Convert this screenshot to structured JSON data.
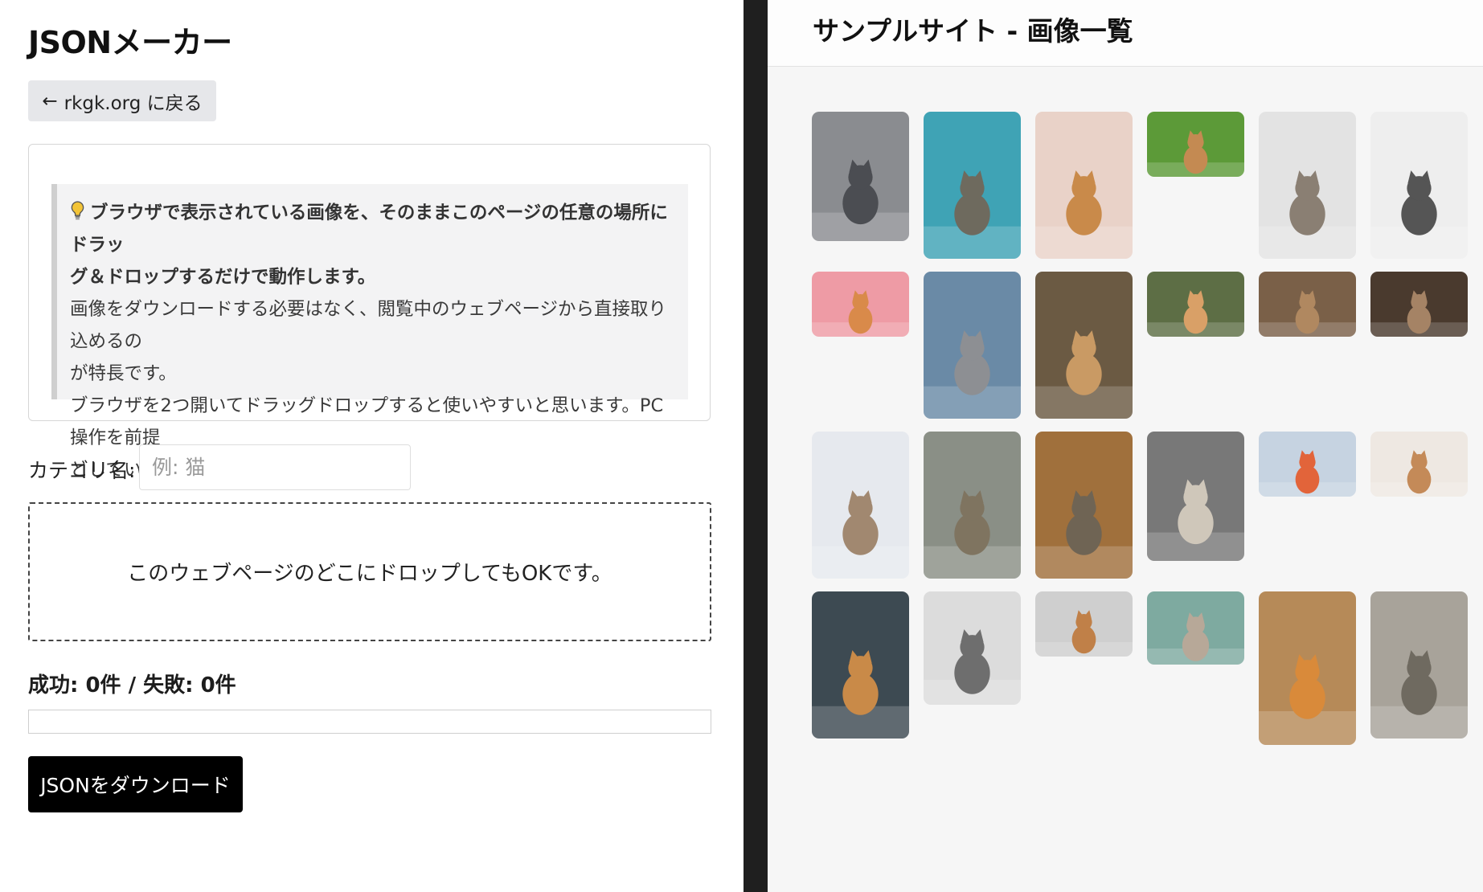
{
  "left": {
    "title": "JSONメーカー",
    "back_button": {
      "arrow": "←",
      "label": "rkgk.org に戻る"
    },
    "info": {
      "icon": "lightbulb-icon",
      "bold_line1": "ブラウザで表示されている画像を、そのままこのページの任意の場所にドラッ",
      "bold_line2": "グ＆ドロップするだけで動作します。",
      "line3": "画像をダウンロードする必要はなく、閲覧中のウェブページから直接取り込めるの",
      "line4": "が特長です。",
      "line5": "ブラウザを2つ開いてドラッグドロップすると使いやすいと思います。PC操作を前提",
      "line6": "としています。"
    },
    "category_label": "カテゴリ名:",
    "category_placeholder": "例: 猫",
    "drop_zone_text": "このウェブページのどこにドロップしてもOKです。",
    "stats_text": "成功: 0件 / 失敗: 0件",
    "progress_fraction": 0,
    "download_button": "JSONをダウンロード"
  },
  "right": {
    "site_title": "サンプルサイト - 画像一覧",
    "images": [
      {
        "name": "cat-sunglasses",
        "bg": "#8a8c90",
        "fg": "#4b4d52"
      },
      {
        "name": "cat-peeking-door",
        "bg": "#3fa3b5",
        "fg": "#6e6a5e"
      },
      {
        "name": "cat-in-box",
        "bg": "#e9d2c8",
        "fg": "#c98a4a"
      },
      {
        "name": "cat-in-grass",
        "bg": "#5c9a38",
        "fg": "#c48a52"
      },
      {
        "name": "cat-sitting-white",
        "bg": "#e3e3e3",
        "fg": "#8a7f73"
      },
      {
        "name": "cat-profile-white",
        "bg": "#eeeeee",
        "fg": "#555555"
      },
      {
        "name": "cat-pink-background",
        "bg": "#ee9ba5",
        "fg": "#d98a4a"
      },
      {
        "name": "cat-sky-portrait",
        "bg": "#6a8aa6",
        "fg": "#8d8f93"
      },
      {
        "name": "cat-fluffy-orange",
        "bg": "#6b5a43",
        "fg": "#c99a64"
      },
      {
        "name": "cat-on-path",
        "bg": "#5d6e45",
        "fg": "#d9a067"
      },
      {
        "name": "cat-on-bench",
        "bg": "#7a6048",
        "fg": "#b08860"
      },
      {
        "name": "cat-lying-dark",
        "bg": "#4a3a2e",
        "fg": "#a58365"
      },
      {
        "name": "cat-lying-white",
        "bg": "#e6e9ee",
        "fg": "#a18870"
      },
      {
        "name": "cat-jumping",
        "bg": "#8a8f86",
        "fg": "#7f7460"
      },
      {
        "name": "cat-closeup-tabby",
        "bg": "#a0703c",
        "fg": "#6f6454"
      },
      {
        "name": "cat-sitting-street",
        "bg": "#787878",
        "fg": "#cfc7ba"
      },
      {
        "name": "cat-cart",
        "bg": "#c6d3e1",
        "fg": "#e2643a"
      },
      {
        "name": "cat-windowsill",
        "bg": "#eee8e2",
        "fg": "#c48a58"
      },
      {
        "name": "cat-window-orange",
        "bg": "#3d4a52",
        "fg": "#c98a48"
      },
      {
        "name": "cat-gray-yawn",
        "bg": "#dcdcdc",
        "fg": "#6e6e6e"
      },
      {
        "name": "cat-window-sleep",
        "bg": "#cfcfcf",
        "fg": "#c08048"
      },
      {
        "name": "cat-lying-teal",
        "bg": "#7eaaa0",
        "fg": "#b7a898"
      },
      {
        "name": "cat-orange-ledge",
        "bg": "#b68a58",
        "fg": "#d98a3a"
      },
      {
        "name": "cat-walking-deck",
        "bg": "#a8a39a",
        "fg": "#6f6a60"
      }
    ]
  }
}
